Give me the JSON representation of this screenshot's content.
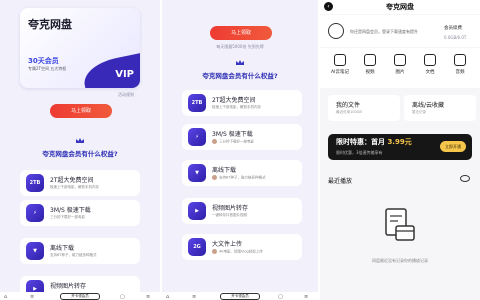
{
  "panel1": {
    "card": {
      "title": "夸克网盘",
      "plan": "30天会员",
      "plan_sub": "专属2T空间 五大特权",
      "badge": "VIP"
    },
    "rules_link": "活动规则",
    "button": "马上领取",
    "section_title": "夸克网盘会员有什么权益?",
    "items": [
      {
        "icon": "2TB",
        "title": "2T超大免费空间",
        "sub": "极速上千部电影，解放手机内存"
      },
      {
        "icon": "⚡",
        "title": "3M/S 极速下载",
        "sub": "三分钟下载好一部电影"
      },
      {
        "icon": "▼",
        "title": "离线下载",
        "sub": "支持BT种子，磁力链多种格式"
      },
      {
        "icon": "▶",
        "title": "视频图片转存",
        "sub": ""
      }
    ],
    "bottom_button": "开卡领会员"
  },
  "panel2": {
    "button": "马上领取",
    "fine_print": "每天限量5000份 先到先得",
    "section_title": "夸克网盘会员有什么权益?",
    "items": [
      {
        "icon": "2TB",
        "title": "2T超大免费空间",
        "sub": "极速上千部电影，解放手机内存"
      },
      {
        "icon": "⚡",
        "title": "3M/S 极速下载",
        "sub": "三分钟下载好一部电影"
      },
      {
        "icon": "▼",
        "title": "离线下载",
        "sub": "支持BT种子，磁力链多种格式"
      },
      {
        "icon": "▶",
        "title": "视频图片转存",
        "sub": "一键转存抖音图片视频"
      },
      {
        "icon": "2G",
        "title": "大文件上传",
        "sub": "4K电影、绘图Vlog轻松上传"
      }
    ],
    "bottom_button": "开卡领会员"
  },
  "panel3": {
    "header": "夸克网盘",
    "user_sub": "你还是网盘会员，登录下载速度有提升",
    "vip_link": "会员续费",
    "storage": "0.0GB/6.0T",
    "tools": [
      {
        "label": "AI云笔记",
        "icon": "ai-note-icon"
      },
      {
        "label": "视频",
        "icon": "video-icon"
      },
      {
        "label": "图片",
        "icon": "image-icon"
      },
      {
        "label": "文档",
        "icon": "document-icon"
      },
      {
        "label": "音频",
        "icon": "audio-icon"
      }
    ],
    "tile_left": {
      "title": "我的文件",
      "sub": "最近可用100GB"
    },
    "tile_right": {
      "title": "离线/云收藏",
      "sub": "暂无记录"
    },
    "promo": {
      "title": "限时特惠：首月",
      "price": "3.99元",
      "sub": "限时优惠，3倍速传输享有",
      "button": "立即开通"
    },
    "recent": "最近播放",
    "empty_text": "网盘最近没有记录你的播放记录"
  }
}
